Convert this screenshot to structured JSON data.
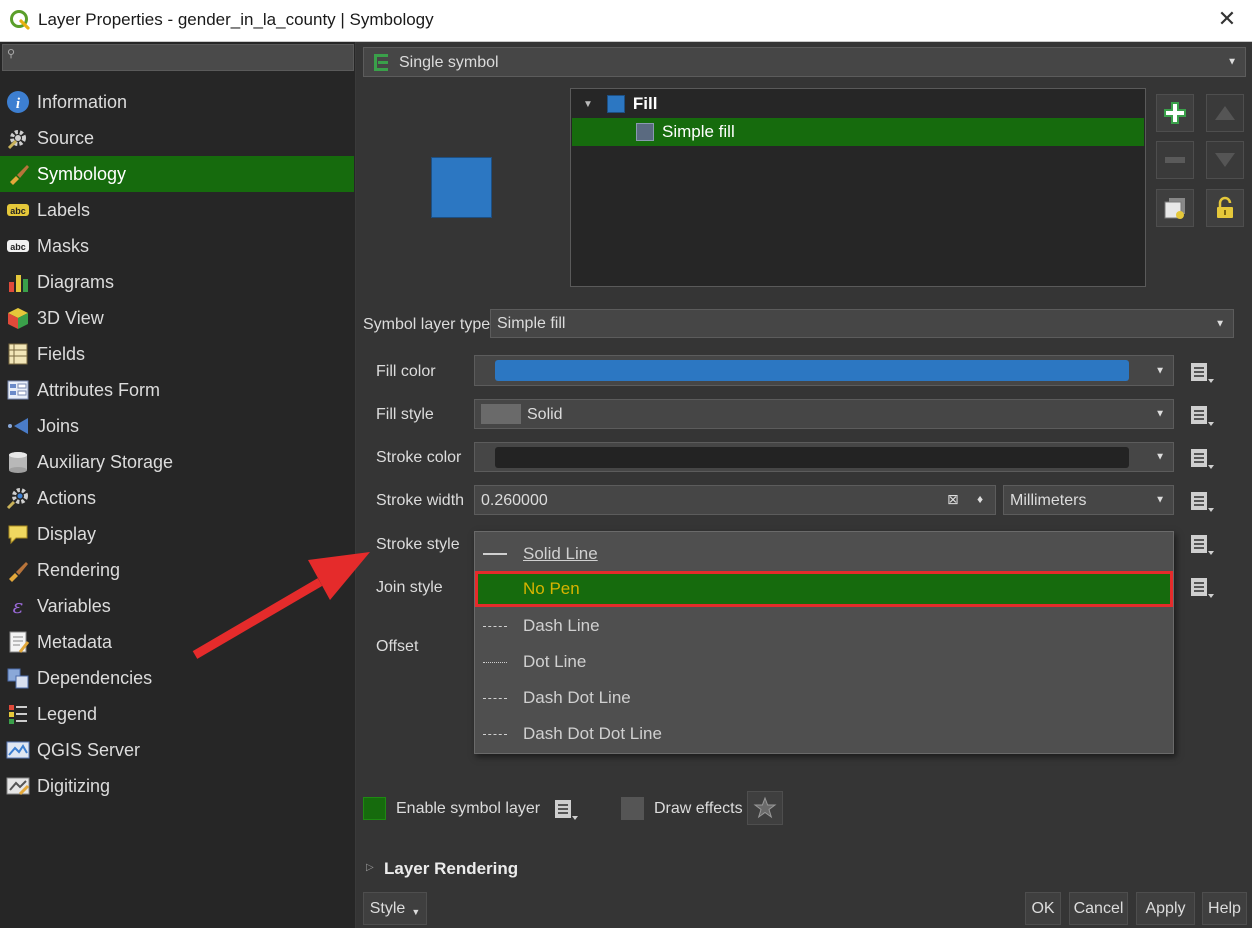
{
  "window": {
    "title": "Layer Properties - gender_in_la_county | Symbology",
    "close_label": "✕"
  },
  "sidebar": {
    "search_placeholder": "",
    "items": [
      {
        "label": "Information",
        "icon": "info-icon"
      },
      {
        "label": "Source",
        "icon": "source-gear-icon"
      },
      {
        "label": "Symbology",
        "icon": "paintbrush-icon"
      },
      {
        "label": "Labels",
        "icon": "labels-abc-icon"
      },
      {
        "label": "Masks",
        "icon": "masks-abc-icon"
      },
      {
        "label": "Diagrams",
        "icon": "diagrams-icon"
      },
      {
        "label": "3D View",
        "icon": "cube-3d-icon"
      },
      {
        "label": "Fields",
        "icon": "fields-icon"
      },
      {
        "label": "Attributes Form",
        "icon": "form-icon"
      },
      {
        "label": "Joins",
        "icon": "joins-icon"
      },
      {
        "label": "Auxiliary Storage",
        "icon": "database-icon"
      },
      {
        "label": "Actions",
        "icon": "actions-gear-icon"
      },
      {
        "label": "Display",
        "icon": "display-bubble-icon"
      },
      {
        "label": "Rendering",
        "icon": "rendering-brush-icon"
      },
      {
        "label": "Variables",
        "icon": "epsilon-icon"
      },
      {
        "label": "Metadata",
        "icon": "metadata-icon"
      },
      {
        "label": "Dependencies",
        "icon": "dependencies-icon"
      },
      {
        "label": "Legend",
        "icon": "legend-icon"
      },
      {
        "label": "QGIS Server",
        "icon": "server-icon"
      },
      {
        "label": "Digitizing",
        "icon": "digitizing-icon"
      }
    ],
    "active_index": 2
  },
  "renderer": {
    "type_label": "Single symbol"
  },
  "symbol_tree": {
    "root_label": "Fill",
    "child_label": "Simple fill",
    "preview_color": "#2c77c2"
  },
  "symbol_layer_type": {
    "label": "Symbol layer type",
    "value": "Simple fill"
  },
  "properties": {
    "fill_color_label": "Fill color",
    "fill_color": "#2c77c2",
    "fill_style_label": "Fill style",
    "fill_style_value": "Solid",
    "stroke_color_label": "Stroke color",
    "stroke_color": "#232323",
    "stroke_width_label": "Stroke width",
    "stroke_width_value": "0.260000",
    "stroke_width_unit": "Millimeters",
    "stroke_style_label": "Stroke style",
    "join_style_label": "Join style",
    "offset_label": "Offset"
  },
  "stroke_style_dropdown": {
    "items": [
      {
        "label": "Solid Line",
        "pattern": "solid"
      },
      {
        "label": "No Pen",
        "pattern": "none"
      },
      {
        "label": "Dash Line",
        "pattern": "dash"
      },
      {
        "label": "Dot Line",
        "pattern": "dot"
      },
      {
        "label": "Dash Dot Line",
        "pattern": "dashdot"
      },
      {
        "label": "Dash Dot Dot Line",
        "pattern": "dashdotdot"
      }
    ],
    "highlighted": "No Pen"
  },
  "footer": {
    "enable_symbol_layer_label": "Enable symbol layer",
    "enable_symbol_layer_checked": true,
    "draw_effects_label": "Draw effects",
    "draw_effects_checked": false,
    "layer_rendering_label": "Layer Rendering",
    "style_label": "Style",
    "ok_label": "OK",
    "cancel_label": "Cancel",
    "apply_label": "Apply",
    "help_label": "Help"
  },
  "colors": {
    "accent_green": "#166b0d",
    "highlight_text": "#d7b400",
    "annotation_red": "#e52b2b"
  }
}
